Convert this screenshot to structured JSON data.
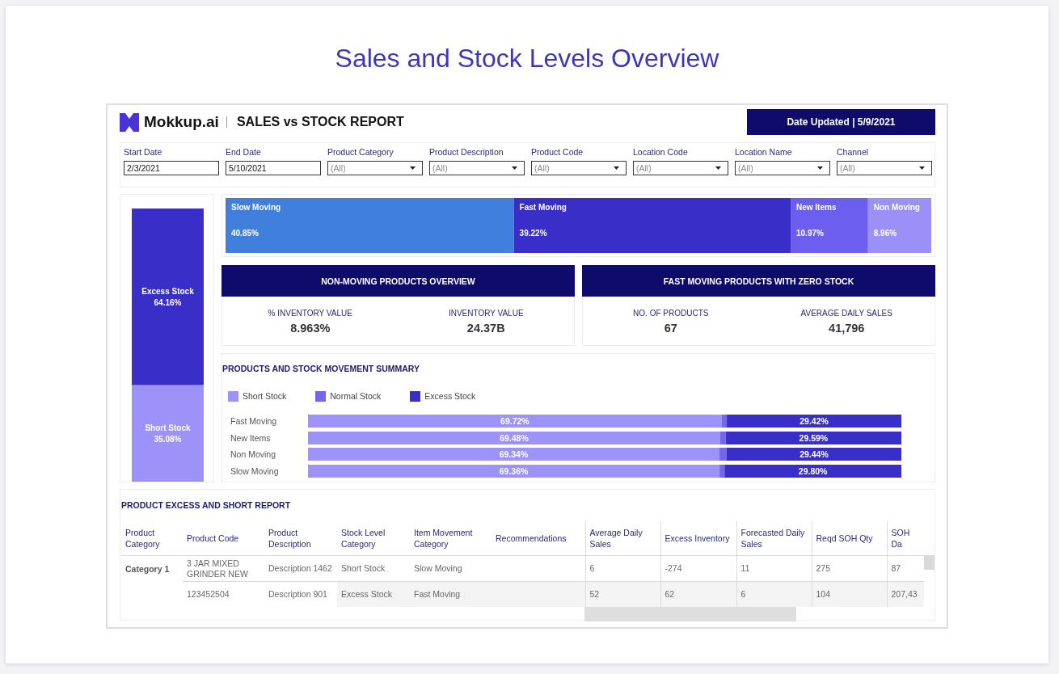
{
  "page_title": "Sales and Stock Levels Overview",
  "header": {
    "brand": "Mokkup.ai",
    "report_title": "SALES vs STOCK REPORT",
    "date_updated": "Date Updated | 5/9/2021"
  },
  "filters": [
    {
      "label": "Start Date",
      "kind": "date",
      "value": "2/3/2021"
    },
    {
      "label": "End Date",
      "kind": "date",
      "value": "5/10/2021"
    },
    {
      "label": "Product Category",
      "kind": "dropdown",
      "value": "(All)"
    },
    {
      "label": "Product Description",
      "kind": "dropdown",
      "value": "(All)"
    },
    {
      "label": "Product Code",
      "kind": "dropdown",
      "value": "(All)"
    },
    {
      "label": "Location Code",
      "kind": "dropdown",
      "value": "(All)"
    },
    {
      "label": "Location Name",
      "kind": "dropdown",
      "value": "(All)"
    },
    {
      "label": "Channel",
      "kind": "dropdown",
      "value": "(All)"
    }
  ],
  "stock_level_chart": {
    "chart_data": {
      "type": "bar",
      "orientation": "vertical",
      "stacked": true,
      "series": [
        {
          "name": "Short Stock",
          "color": "#9d92f7",
          "values": [
            35.08
          ],
          "value_labels": [
            "35.08%"
          ]
        },
        {
          "name": "Excess Stock",
          "color": "#3a2ec8",
          "values": [
            64.16
          ],
          "value_labels": [
            "64.16%"
          ]
        }
      ]
    }
  },
  "movement_share_chart": {
    "chart_data": {
      "type": "bar",
      "orientation": "horizontal",
      "stacked": true,
      "series": [
        {
          "name": "Slow Moving",
          "color": "#4080dc",
          "values": [
            40.85
          ],
          "value_labels": [
            "40.85%"
          ]
        },
        {
          "name": "Fast Moving",
          "color": "#3a2ec8",
          "values": [
            39.22
          ],
          "value_labels": [
            "39.22%"
          ]
        },
        {
          "name": "New Items",
          "color": "#6c5ff0",
          "values": [
            10.97
          ],
          "value_labels": [
            "10.97%"
          ]
        },
        {
          "name": "Non Moving",
          "color": "#9b90f8",
          "values": [
            8.96
          ],
          "value_labels": [
            "8.96%"
          ]
        }
      ]
    }
  },
  "kpi_cards": [
    {
      "title": "NON-MOVING PRODUCTS OVERVIEW",
      "metrics": [
        {
          "label": "% INVENTORY VALUE",
          "value": "8.963%"
        },
        {
          "label": "INVENTORY VALUE",
          "value": "24.37B"
        }
      ]
    },
    {
      "title": "FAST MOVING PRODUCTS WITH ZERO STOCK",
      "metrics": [
        {
          "label": "NO. OF PRODUCTS",
          "value": "67"
        },
        {
          "label": "AVERAGE DAILY SALES",
          "value": "41,796"
        }
      ]
    }
  ],
  "movement_summary": {
    "chart_data": {
      "type": "bar",
      "title": "PRODUCTS AND STOCK MOVEMENT SUMMARY",
      "orientation": "horizontal",
      "stacked": true,
      "legend": "top",
      "categories": [
        "Fast Moving",
        "New Items",
        "Non Moving",
        "Slow Moving"
      ],
      "series": [
        {
          "name": "Short Stock",
          "color": "#9d92f7",
          "values": [
            69.72,
            69.48,
            69.34,
            69.36
          ],
          "value_labels": [
            "69.72%",
            "69.48%",
            "69.34%",
            "69.36%"
          ]
        },
        {
          "name": "Normal Stock",
          "color": "#7467ef",
          "values": [
            0.86,
            0.93,
            1.22,
            0.84
          ],
          "value_labels": [
            null,
            null,
            null,
            null
          ]
        },
        {
          "name": "Excess Stock",
          "color": "#3a2ec8",
          "values": [
            29.42,
            29.59,
            29.44,
            29.8
          ],
          "value_labels": [
            "29.42%",
            "29.59%",
            "29.44%",
            "29.80%"
          ]
        }
      ]
    }
  },
  "report_table": {
    "title": "PRODUCT EXCESS AND SHORT REPORT",
    "columns": [
      "Product Category",
      "Product Code",
      "Product Description",
      "Stock Level Category",
      "Item Movement Category",
      "Recommendations",
      "Average Daily Sales",
      "Excess Inventory",
      "Forecasted Daily Sales",
      "Reqd SOH Qty",
      "SOH Da"
    ],
    "groups": [
      {
        "product_category": "Category 1",
        "rows": [
          {
            "product_code": "3 JAR MIXED GRINDER NEW",
            "product_description": "Description 1462",
            "stock_level_category": "Short Stock",
            "item_movement_category": "Slow Moving",
            "average_daily_sales": "6",
            "excess_inventory": "-274",
            "forecasted_daily_sales": "11",
            "reqd_soh_qty": "275",
            "column_11": "87"
          },
          {
            "product_code": "123452504",
            "product_description": "Description 901",
            "stock_level_category": "Excess Stock",
            "item_movement_category": "Fast Moving",
            "average_daily_sales": "52",
            "excess_inventory": "62",
            "forecasted_daily_sales": "6",
            "reqd_soh_qty": "104",
            "column_11": "207,43"
          }
        ]
      }
    ]
  }
}
